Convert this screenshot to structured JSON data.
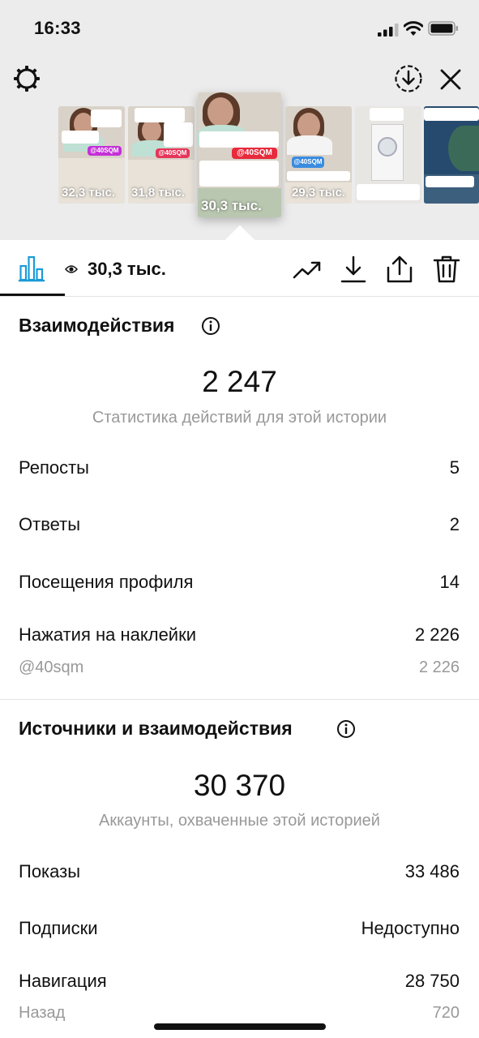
{
  "status": {
    "time": "16:33"
  },
  "thumbnails": [
    {
      "count": "32,3 тыс.",
      "tag": "@40SQM",
      "tag_color": "#c430d8"
    },
    {
      "count": "31,8 тыс.",
      "tag": "@40SQM",
      "tag_color": "#e6365a"
    },
    {
      "count": "30,3 тыс.",
      "tag": "@40SQM",
      "tag_color": "#e82a3c"
    },
    {
      "count": "29,3 тыс.",
      "tag": "@40SQM",
      "tag_color": "#3a8ce0"
    },
    {
      "count": "",
      "tag": "",
      "tag_color": "#ffffff"
    },
    {
      "count": "",
      "tag": "",
      "tag_color": "#ffffff"
    }
  ],
  "toolbar": {
    "views": "30,3 тыс."
  },
  "interactions": {
    "title": "Взаимодействия",
    "total": "2 247",
    "subtitle": "Статистика действий для этой истории",
    "rows": [
      {
        "label": "Репосты",
        "value": "5"
      },
      {
        "label": "Ответы",
        "value": "2"
      },
      {
        "label": "Посещения профиля",
        "value": "14"
      },
      {
        "label": "Нажатия на наклейки",
        "value": "2 226"
      }
    ],
    "sticker_sub": {
      "label": "@40sqm",
      "value": "2 226"
    }
  },
  "discovery": {
    "title": "Источники и взаимодействия",
    "total": "30 370",
    "subtitle": "Аккаунты, охваченные этой историей",
    "rows": [
      {
        "label": "Показы",
        "value": "33 486"
      },
      {
        "label": "Подписки",
        "value": "Недоступно"
      },
      {
        "label": "Навигация",
        "value": "28 750"
      }
    ],
    "nav_sub": {
      "label": "Назад",
      "value": "720"
    }
  },
  "colors": {
    "accent": "#1a9bd7",
    "muted": "#999999"
  }
}
